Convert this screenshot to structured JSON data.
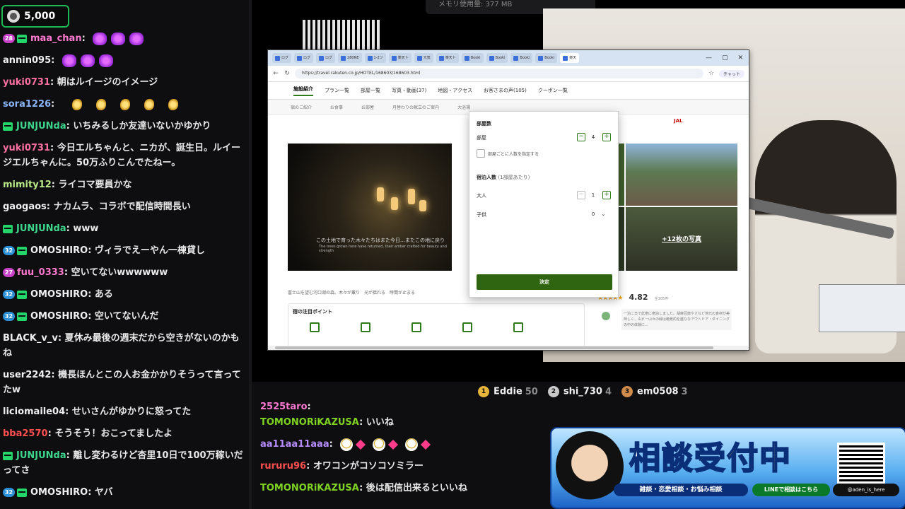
{
  "points": {
    "value": "5,000"
  },
  "left_chat": [
    {
      "badge": "28",
      "badge_color": "#c840c8",
      "sub": true,
      "user": "maa_chan",
      "user_color": "#ff78d0",
      "text": "",
      "emotes": [
        "bow",
        "bow",
        "bow"
      ]
    },
    {
      "badge": "",
      "sub": false,
      "user": "annin095",
      "user_color": "#efeff1",
      "text": "",
      "emotes": [
        "bow",
        "bow",
        "bow"
      ]
    },
    {
      "badge": "",
      "sub": false,
      "user": "yuki0731",
      "user_color": "#ff6fa1",
      "text": "朝はルイージのイメージ",
      "emotes": []
    },
    {
      "badge": "",
      "sub": false,
      "user": "sora1226",
      "user_color": "#8ab4f8",
      "text": "",
      "emotes": [
        "gold",
        "gold",
        "gold",
        "gold",
        "gold"
      ]
    },
    {
      "badge": "",
      "sub": true,
      "user": "JUNJUNda",
      "user_color": "#3dd68c",
      "text": "いちみるしか友達いないかゆかり",
      "emotes": []
    },
    {
      "badge": "",
      "sub": false,
      "user": "yuki0731",
      "user_color": "#ff6fa1",
      "text": "今日エルちゃんと、ニカが、誕生日。ルイージエルちゃんに。50万ふりこんでたねー。",
      "emotes": []
    },
    {
      "badge": "",
      "sub": false,
      "user": "mimity12",
      "user_color": "#b8e986",
      "text": "ライコマ要員かな",
      "emotes": []
    },
    {
      "badge": "",
      "sub": false,
      "user": "gaogaos",
      "user_color": "#efeff1",
      "text": "ナカムラ、コラボで配信時間長い",
      "emotes": []
    },
    {
      "badge": "",
      "sub": true,
      "user": "JUNJUNda",
      "user_color": "#3dd68c",
      "text": "www",
      "emotes": []
    },
    {
      "badge": "32",
      "badge_color": "#2a8fd6",
      "sub": true,
      "user": "OMOSHIRO",
      "user_color": "#efeff1",
      "text": "ヴィラでえーやん一棟貸し",
      "emotes": []
    },
    {
      "badge": "27",
      "badge_color": "#c840c8",
      "sub": false,
      "user": "fuu_0333",
      "user_color": "#ff78d0",
      "text": "空いてないwwwwww",
      "emotes": []
    },
    {
      "badge": "32",
      "badge_color": "#2a8fd6",
      "sub": true,
      "user": "OMOSHIRO",
      "user_color": "#efeff1",
      "text": "ある",
      "emotes": []
    },
    {
      "badge": "32",
      "badge_color": "#2a8fd6",
      "sub": true,
      "user": "OMOSHIRO",
      "user_color": "#efeff1",
      "text": "空いてないんだ",
      "emotes": []
    },
    {
      "badge": "",
      "sub": false,
      "user": "BLACK_v_v",
      "user_color": "#efeff1",
      "text": "夏休み最後の週末だから空きがないのかもね",
      "emotes": []
    },
    {
      "badge": "",
      "sub": false,
      "user": "user2242",
      "user_color": "#efeff1",
      "text": "機長ほんとこの人お金かかりそうって言ってたw",
      "emotes": []
    },
    {
      "badge": "",
      "sub": false,
      "user": "liciomaile04",
      "user_color": "#efeff1",
      "text": "せいさんがゆかりに怒ってた",
      "emotes": []
    },
    {
      "badge": "",
      "sub": false,
      "user": "bba2570",
      "user_color": "#ff4f4f",
      "text": "そうそう！おこってましたよ",
      "emotes": []
    },
    {
      "badge": "",
      "sub": true,
      "user": "JUNJUNda",
      "user_color": "#3dd68c",
      "text": "離し変わるけど杏里10日で100万稼いだってさ",
      "emotes": []
    },
    {
      "badge": "32",
      "badge_color": "#2a8fd6",
      "sub": true,
      "user": "OMOSHIRO",
      "user_color": "#efeff1",
      "text": "ヤバ",
      "emotes": []
    }
  ],
  "memory_label": "メモリ使用量: 377 MB",
  "browser": {
    "tabs": [
      "ログ",
      "ログ",
      "ログ",
      "280NE",
      "1-2ツ",
      "楽天ト",
      "元気",
      "楽天ト",
      "Booki",
      "Booki",
      "Booki",
      "Booki",
      "楽天"
    ],
    "url": "https://travel.rakuten.co.jp/HOTEL/168603/168603.html",
    "chat_ai": "チャット",
    "nav_tabs": [
      "施設紹介",
      "プラン一覧",
      "部屋一覧",
      "写真・動画(37)",
      "地図・アクセス",
      "お客さまの声(105)",
      "クーポン一覧"
    ],
    "sub_nav": [
      "宿のご紹介",
      "お食事",
      "お部屋",
      "月替わりの献立のご案内",
      "大浴場"
    ],
    "video_caption": "この土地で育った木々たちはまた今日…またこの地に戻り",
    "video_caption_en": "The trees grown here have returned, their amber crafted for beauty and strength",
    "photo_more": "+12枚の写真",
    "jal_label": "JAL",
    "description": "富士山を望む河口湖の森。木々が薫り　光が揺れる　時間が止まる",
    "points_title": "宿の注目ポイント",
    "review_score": "4.82",
    "review_stars": "★★★★★",
    "review_count": "全105件",
    "review_text": "一泊二日で此宿に宿泊しました。胡麻豆腐やさなど地元の食材が美味しく、山ビー山々の緑は絶景的を盛ななアウトドア・ダイニングの中の体験に..."
  },
  "popup": {
    "rooms_heading": "部屋数",
    "room_label": "部屋",
    "room_value": "4",
    "per_room_checkbox": "部屋ごとに人数を指定する",
    "guests_heading": "宿泊人数",
    "guests_sub": "(1部屋あたり)",
    "adult_label": "大人",
    "adult_value": "1",
    "child_label": "子供",
    "child_value": "0",
    "decide_label": "決定"
  },
  "leaderboard": [
    {
      "rank": "1",
      "color": "#e8b53c",
      "name": "Eddie",
      "count": "50"
    },
    {
      "rank": "2",
      "color": "#c9c9c9",
      "name": "shi_730",
      "count": "4"
    },
    {
      "rank": "3",
      "color": "#d08a4a",
      "name": "em0508",
      "count": "3"
    }
  ],
  "bottom_chat": [
    {
      "user": "2525taro",
      "user_color": "#ff78d0",
      "text": ""
    },
    {
      "user": "TOMONORiKAZUSA",
      "user_color": "#7ed321",
      "text": "いいね"
    },
    {
      "user": "aa11aa11aaa",
      "user_color": "#b68cff",
      "text": ""
    },
    {
      "user": "rururu96",
      "user_color": "#ff4f4f",
      "text": "オワコンがコソコソミラー"
    },
    {
      "user": "TOMONORiKAZUSA",
      "user_color": "#7ed321",
      "text": "後は配信出来るといいね"
    }
  ],
  "banner": {
    "title_a": "相談",
    "title_b": "受付中",
    "sub": "雑談・恋愛相談・お悩み相談",
    "line": "LINEで相談はこちら",
    "x_handle": "@aden_is_here"
  }
}
